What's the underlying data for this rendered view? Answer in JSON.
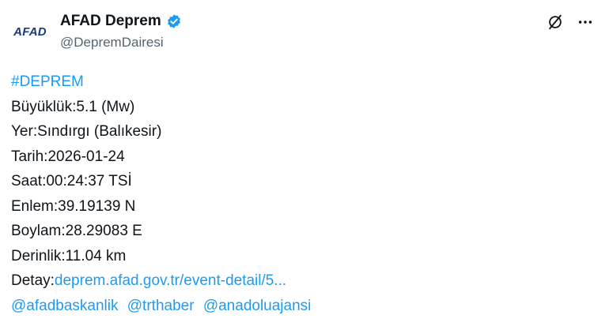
{
  "account": {
    "avatar_text": "AFAD",
    "display_name": "AFAD Deprem",
    "handle": "@DepremDairesi"
  },
  "tweet": {
    "hashtag": "#DEPREM",
    "lines": [
      "Büyüklük:5.1 (Mw)",
      "Yer:Sındırgı (Balıkesir)",
      "Tarih:2026-01-24",
      "Saat:00:24:37 TSİ",
      "Enlem:39.19139 N",
      "Boylam:28.29083 E",
      "Derinlik:11.04 km"
    ],
    "detail_label": "Detay:",
    "detail_link": "deprem.afad.gov.tr/event-detail/5...",
    "mentions": [
      "@afadbaskanlik",
      "@trthaber",
      "@anadoluajansi"
    ]
  },
  "colors": {
    "link": "#1d9bf0",
    "verified": "#1d9bf0",
    "text": "#0f1419",
    "secondary": "#536471"
  },
  "icons": [
    "verified-badge-icon",
    "grok-icon",
    "more-icon"
  ]
}
